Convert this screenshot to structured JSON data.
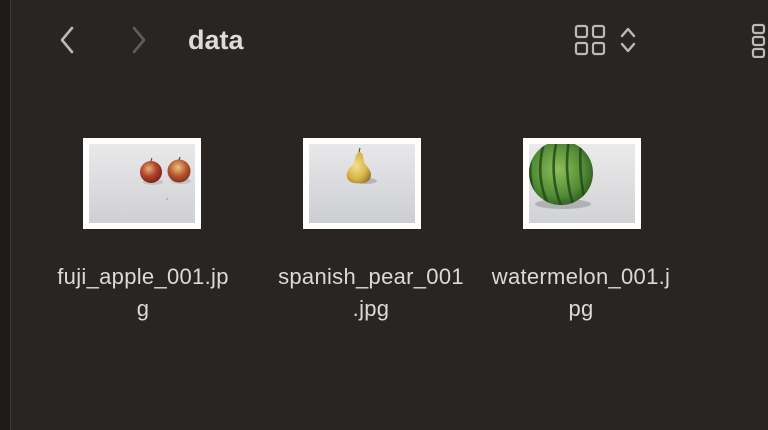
{
  "window": {
    "background": "#282523",
    "text_color": "#dcd9d6"
  },
  "toolbar": {
    "back_icon": "chevron-left-icon",
    "forward_icon": "chevron-right-icon",
    "folder_title": "data",
    "view_icon": "icon-grid-view-icon",
    "view_options_icon": "chevron-up-down-icon",
    "group_icon": "group-view-icon"
  },
  "files": [
    {
      "name_line1": "fuji_apple_001.jp",
      "name_line2": "g",
      "thumbnail": "two red apples on white table"
    },
    {
      "name_line1": "spanish_pear_001",
      "name_line2": ".jpg",
      "thumbnail": "single yellow pear on white table"
    },
    {
      "name_line1": "watermelon_001.j",
      "name_line2": "pg",
      "thumbnail": "striped green watermelon on white table"
    }
  ]
}
